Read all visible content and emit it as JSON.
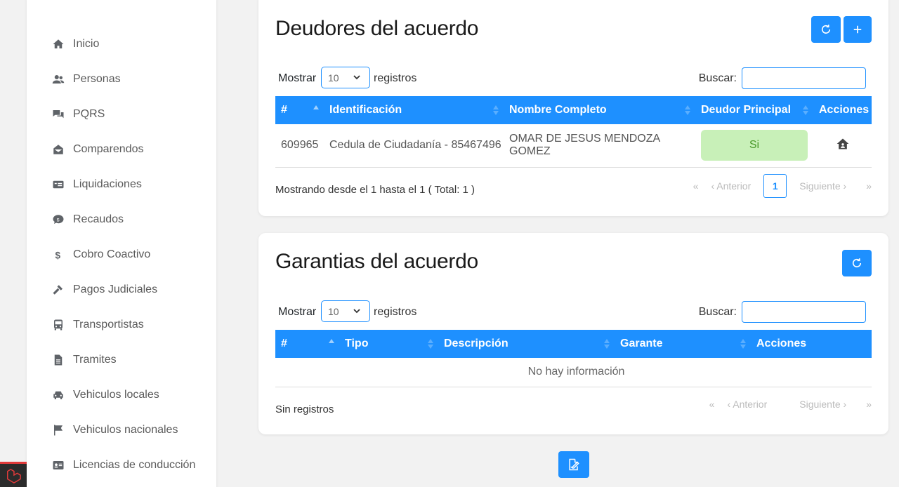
{
  "sidebar": {
    "items": [
      {
        "label": "Inicio",
        "icon": "home-icon"
      },
      {
        "label": "Personas",
        "icon": "users-icon"
      },
      {
        "label": "PQRS",
        "icon": "comments-icon"
      },
      {
        "label": "Comparendos",
        "icon": "envelope-open-icon"
      },
      {
        "label": "Liquidaciones",
        "icon": "money-bill-icon"
      },
      {
        "label": "Recaudos",
        "icon": "comment-dollar-icon"
      },
      {
        "label": "Cobro Coactivo",
        "icon": "dollar-icon"
      },
      {
        "label": "Pagos Judiciales",
        "icon": "gavel-icon"
      },
      {
        "label": "Transportistas",
        "icon": "bus-icon"
      },
      {
        "label": "Tramites",
        "icon": "file-icon"
      },
      {
        "label": "Vehiculos locales",
        "icon": "car-icon"
      },
      {
        "label": "Vehiculos nacionales",
        "icon": "flag-icon"
      },
      {
        "label": "Licencias de conducción",
        "icon": "id-card-icon"
      }
    ]
  },
  "deudores": {
    "title": "Deudores del acuerdo",
    "mostrar_label": "Mostrar",
    "page_size": "10",
    "registros_label": "registros",
    "buscar_label": "Buscar:",
    "buscar_value": "",
    "columns": [
      "#",
      "Identificación",
      "Nombre Completo",
      "Deudor Principal",
      "Acciones"
    ],
    "rows": [
      {
        "id": "609965",
        "identificacion": "Cedula de Ciudadanía - 85467496",
        "nombre": "OMAR DE JESUS MENDOZA GOMEZ",
        "principal": "Si",
        "accion_icon": "house-user-icon"
      }
    ],
    "footer": "Mostrando desde el 1 hasta el 1 ( Total: 1 )",
    "pager": {
      "first": "«",
      "prev": "‹ Anterior",
      "current": "1",
      "next": "Siguiente ›",
      "last": "»"
    }
  },
  "garantias": {
    "title": "Garantias del acuerdo",
    "mostrar_label": "Mostrar",
    "page_size": "10",
    "registros_label": "registros",
    "buscar_label": "Buscar:",
    "buscar_value": "",
    "columns": [
      "#",
      "Tipo",
      "Descripción",
      "Garante",
      "Acciones"
    ],
    "empty": "No hay información",
    "footer": "Sin registros",
    "pager": {
      "first": "«",
      "prev": "‹ Anterior",
      "next": "Siguiente ›",
      "last": "»"
    }
  },
  "colors": {
    "primary": "#1e90ff",
    "success_bg": "#c8f0b8",
    "success_text": "#4a9a2a"
  }
}
